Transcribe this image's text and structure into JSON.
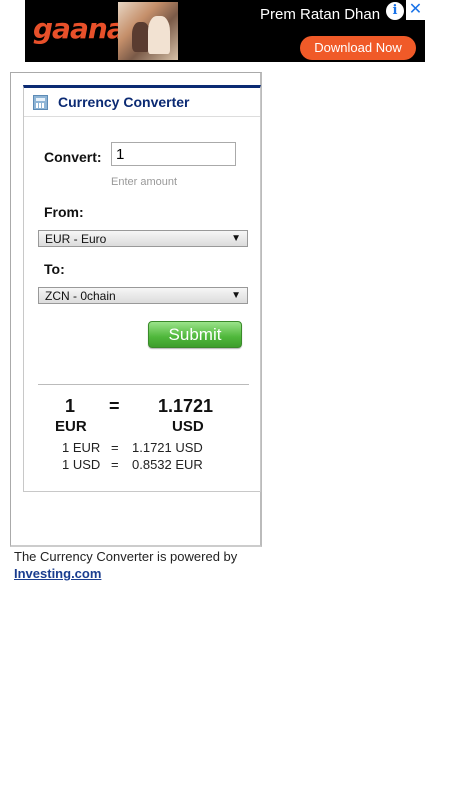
{
  "ad": {
    "brand": "gaana",
    "headline": "Prem Ratan Dhan",
    "info_symbol": "i",
    "close_symbol": "✕",
    "cta": "Download Now",
    "colors": {
      "brand": "#e8502a",
      "cta": "#f05a28"
    }
  },
  "widget": {
    "title": "Currency Converter",
    "convert_label": "Convert:",
    "amount_value": "1",
    "amount_hint": "Enter amount",
    "from_label": "From:",
    "from_value": "EUR - Euro",
    "to_label": "To:",
    "to_value": "ZCN - 0chain",
    "submit_label": "Submit",
    "result": {
      "from_amount": "1",
      "equals": "=",
      "to_amount": "1.1721",
      "from_code": "EUR",
      "to_code": "USD",
      "rate1": {
        "lhs": "1 EUR",
        "eq": "=",
        "rhs": "1.1721 USD"
      },
      "rate2": {
        "lhs": "1 USD",
        "eq": "=",
        "rhs": "0.8532 EUR"
      }
    },
    "colors": {
      "title": "#0b2a73",
      "submit": "#4fb73b"
    }
  },
  "footer": {
    "powered_text": "The Currency Converter is powered by",
    "link_text": "Investing.com"
  },
  "icons": [
    "info-icon",
    "close-icon",
    "calculator-icon",
    "chevron-down-icon"
  ]
}
